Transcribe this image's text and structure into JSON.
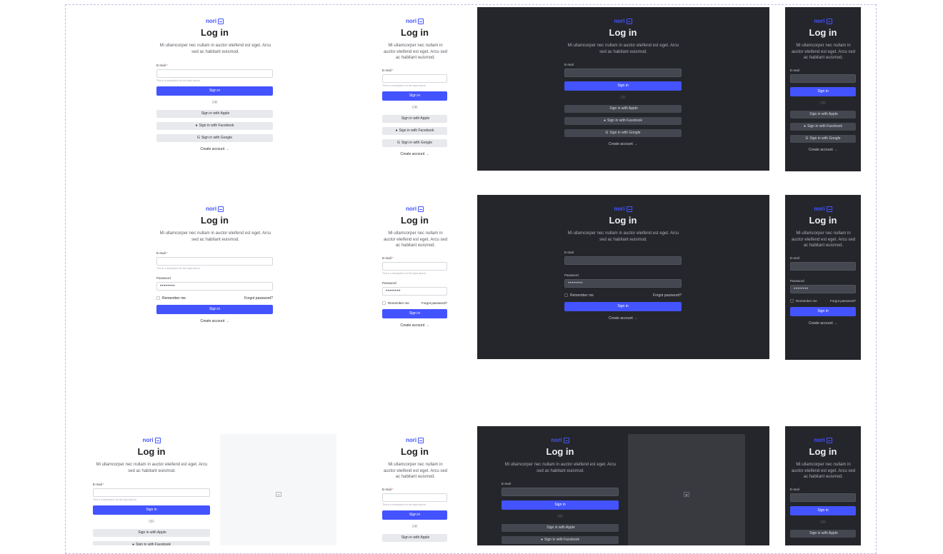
{
  "brand": {
    "name": "nori",
    "accent": "#4353ff",
    "dark_bg": "#25262b"
  },
  "login": {
    "title": "Log in",
    "description": "Mi ullamcorper nec nullam in auctor eleifend est eget. Arcu sed ac habitant euismod.",
    "email_label": "E-mail",
    "email_hint": "This is a description for the input above.",
    "password_label": "Password",
    "password_value": "••••••••",
    "remember_label": "Remember me",
    "forgot_label": "Forgot password?",
    "sign_in_label": "Sign in",
    "or_label": "OR",
    "apple_label": "Sign in with Apple",
    "facebook_label": "Sign in with Facebook",
    "google_label": "Sign in with Google",
    "create_label": "Create account"
  },
  "icons": {
    "apple": "apple-icon",
    "facebook": "facebook-icon",
    "google": "google-icon",
    "arrow": "arrow-right-icon",
    "image": "image-placeholder-icon"
  }
}
